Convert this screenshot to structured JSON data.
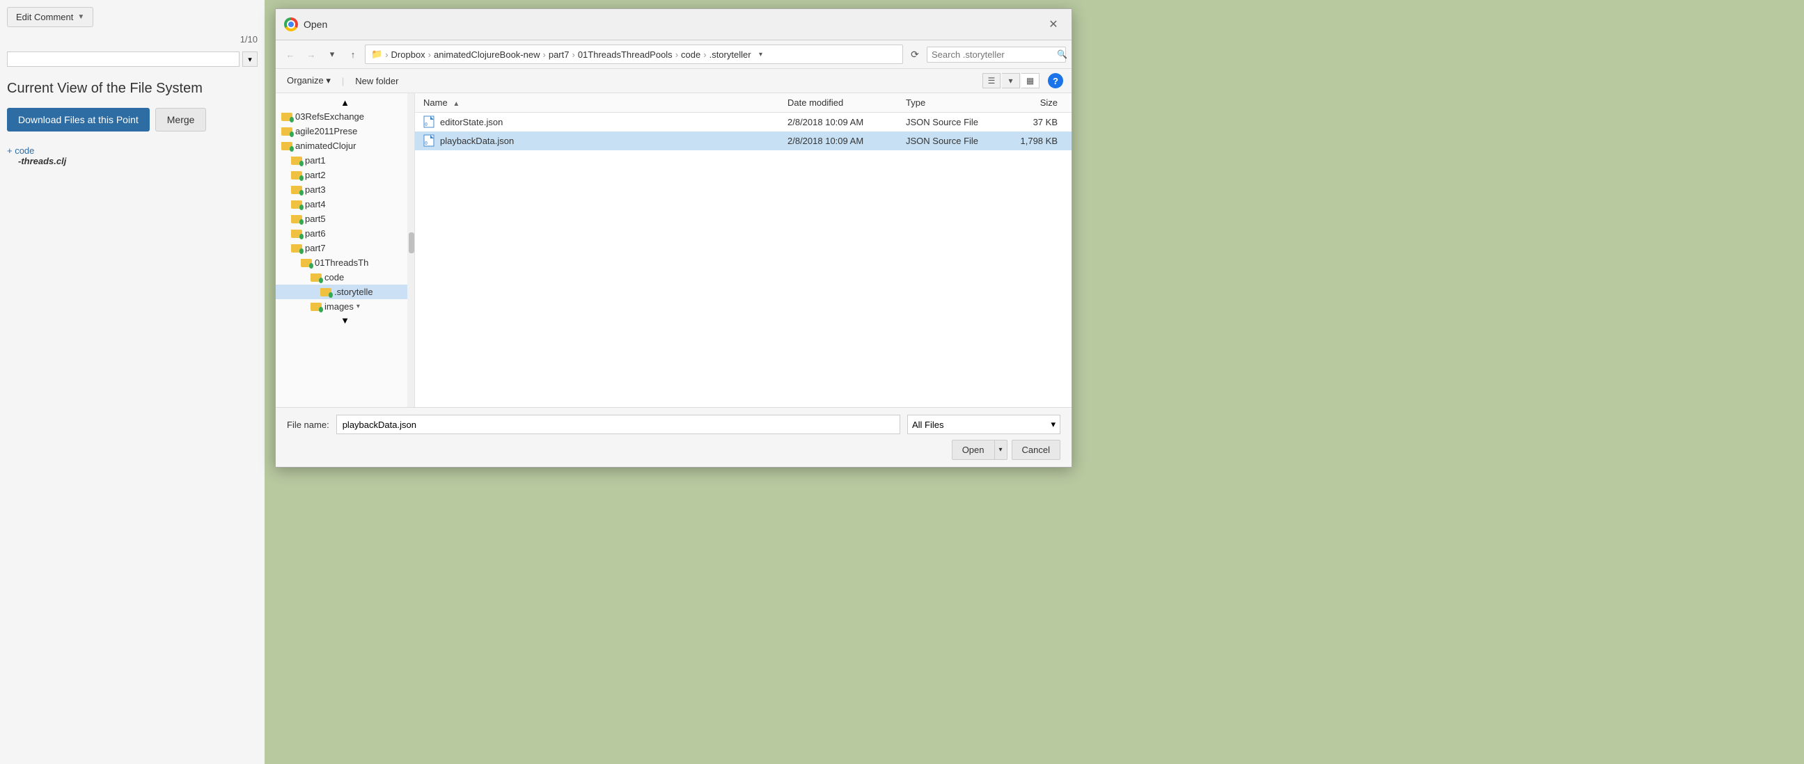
{
  "left_panel": {
    "edit_comment_btn": "Edit Comment",
    "edit_comment_chevron": "▼",
    "page_counter": "1/10",
    "section_title": "Current View of the File System",
    "download_btn": "Download Files at this Point",
    "merge_btn": "Merge",
    "file_tree_folder": "+ code",
    "file_tree_file": "-threads.clj"
  },
  "dialog": {
    "title": "Open",
    "close_btn": "✕",
    "nav": {
      "back": "←",
      "forward": "→",
      "dropdown": "▾",
      "up": "↑",
      "breadcrumb": [
        {
          "label": "Dropbox"
        },
        {
          "label": "animatedClojureBook-new"
        },
        {
          "label": "part7"
        },
        {
          "label": "01ThreadsThreadPools"
        },
        {
          "label": "code"
        },
        {
          "label": ".storyteller"
        }
      ],
      "breadcrumb_dropdown": "▾",
      "refresh": "⟳",
      "search_placeholder": "Search .storyteller",
      "search_icon": "🔍"
    },
    "toolbar": {
      "organize": "Organize ▾",
      "new_folder": "New folder",
      "view_list": "☰",
      "view_panel": "▦",
      "help": "?"
    },
    "tree_items": [
      {
        "label": "03RefsExchange",
        "indent": 0,
        "selected": false
      },
      {
        "label": "agile2011Prese",
        "indent": 0,
        "selected": false
      },
      {
        "label": "animatedClojur",
        "indent": 0,
        "selected": false
      },
      {
        "label": "part1",
        "indent": 1,
        "selected": false
      },
      {
        "label": "part2",
        "indent": 1,
        "selected": false
      },
      {
        "label": "part3",
        "indent": 1,
        "selected": false
      },
      {
        "label": "part4",
        "indent": 1,
        "selected": false
      },
      {
        "label": "part5",
        "indent": 1,
        "selected": false
      },
      {
        "label": "part6",
        "indent": 1,
        "selected": false
      },
      {
        "label": "part7",
        "indent": 1,
        "selected": false
      },
      {
        "label": "01ThreadsTh",
        "indent": 2,
        "selected": false
      },
      {
        "label": "code",
        "indent": 3,
        "selected": false
      },
      {
        "label": ".storytelle",
        "indent": 4,
        "selected": true
      },
      {
        "label": "images",
        "indent": 3,
        "selected": false
      }
    ],
    "file_list": {
      "headers": [
        {
          "label": "Name",
          "key": "name",
          "arrow": ""
        },
        {
          "label": "Date modified",
          "key": "date"
        },
        {
          "label": "Type",
          "key": "type"
        },
        {
          "label": "Size",
          "key": "size"
        }
      ],
      "files": [
        {
          "name": "editorState.json",
          "date": "2/8/2018 10:09 AM",
          "type": "JSON Source File",
          "size": "37 KB",
          "selected": false
        },
        {
          "name": "playbackData.json",
          "date": "2/8/2018 10:09 AM",
          "type": "JSON Source File",
          "size": "1,798 KB",
          "selected": true
        }
      ]
    },
    "bottom": {
      "filename_label": "File name:",
      "filename_value": "playbackData.json",
      "filetype_value": "All Files",
      "open_btn": "Open",
      "open_arrow": "▾",
      "cancel_btn": "Cancel"
    }
  }
}
